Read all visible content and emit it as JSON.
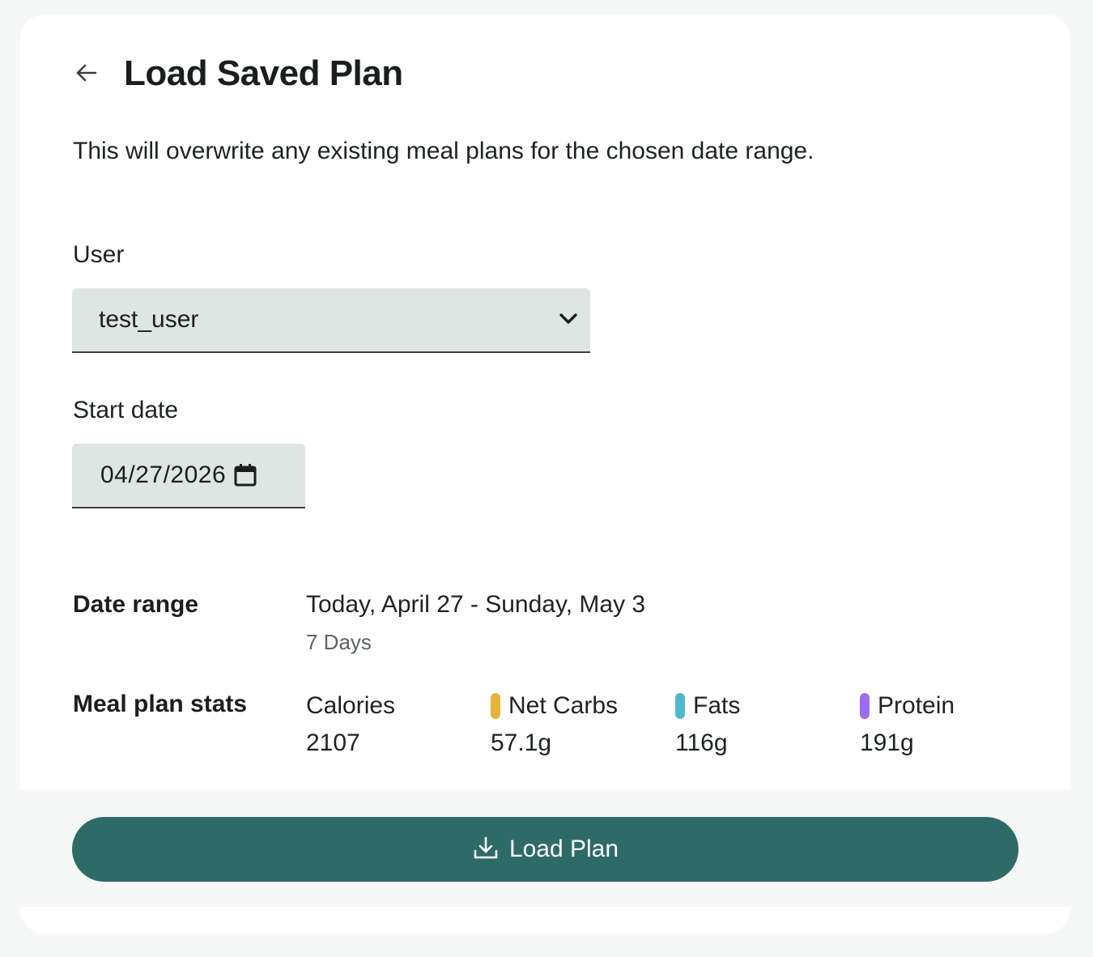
{
  "header": {
    "title": "Load Saved Plan"
  },
  "warning_text": "This will overwrite any existing meal plans for the chosen date range.",
  "user_field": {
    "label": "User",
    "selected": "test_user"
  },
  "start_date_field": {
    "label": "Start date",
    "value": "04/27/2026"
  },
  "date_range": {
    "label": "Date range",
    "range": "Today, April 27 - Sunday, May 3",
    "days": "7 Days"
  },
  "stats": {
    "label": "Meal plan stats",
    "items": [
      {
        "name": "Calories",
        "value": "2107",
        "color": ""
      },
      {
        "name": "Net Carbs",
        "value": "57.1g",
        "color": "#e6b43c"
      },
      {
        "name": "Fats",
        "value": "116g",
        "color": "#4bb8cc"
      },
      {
        "name": "Protein",
        "value": "191g",
        "color": "#9b6cf0"
      }
    ]
  },
  "footer": {
    "load_label": "Load Plan"
  },
  "colors": {
    "accent": "#2e6a68",
    "field_bg": "#dfe5e3",
    "page_bg": "#f5f8f7"
  },
  "icons": {
    "back": "arrow-left-icon",
    "dropdown": "chevron-down-icon",
    "calendar": "calendar-icon",
    "load": "download-icon"
  }
}
